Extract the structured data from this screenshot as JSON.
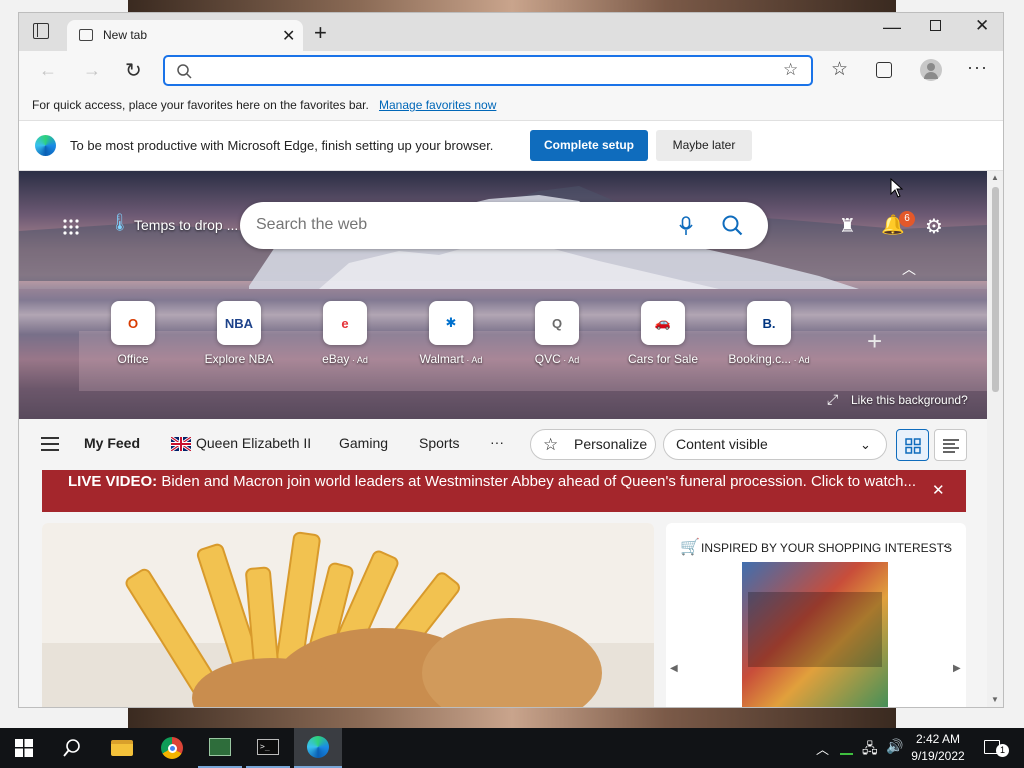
{
  "tab": {
    "title": "New tab"
  },
  "address": {
    "value": "",
    "placeholder": ""
  },
  "favbar": {
    "text": "For quick access, place your favorites here on the favorites bar.",
    "link": "Manage favorites now"
  },
  "setup": {
    "message": "To be most productive with Microsoft Edge, finish setting up your browser.",
    "primary": "Complete setup",
    "secondary": "Maybe later"
  },
  "hero": {
    "weather": "Temps to drop ...",
    "search_placeholder": "Search the web",
    "notif_count": "6",
    "like_bg": "Like this background?"
  },
  "tiles": [
    {
      "label": "Office",
      "ad": "",
      "icon": "office-icon",
      "color": "#d83b01",
      "glyph": "O"
    },
    {
      "label": "Explore NBA",
      "ad": "",
      "icon": "nba-icon",
      "color": "#1d428a",
      "glyph": "NBA"
    },
    {
      "label": "eBay",
      "ad": " · Ad",
      "icon": "ebay-icon",
      "color": "#e53238",
      "glyph": "e"
    },
    {
      "label": "Walmart",
      "ad": " · Ad",
      "icon": "walmart-icon",
      "color": "#0071ce",
      "glyph": "✱"
    },
    {
      "label": "QVC",
      "ad": " · Ad",
      "icon": "qvc-icon",
      "color": "#6b6b6b",
      "glyph": "Q"
    },
    {
      "label": "Cars for Sale",
      "ad": "",
      "icon": "car-icon",
      "color": "#e6522c",
      "glyph": "🚗"
    },
    {
      "label": "Booking.c...",
      "ad": " · Ad",
      "icon": "booking-icon",
      "color": "#003580",
      "glyph": "B."
    }
  ],
  "feed": {
    "my_feed": "My Feed",
    "topics": [
      "Queen Elizabeth II",
      "Gaming",
      "Sports"
    ],
    "more": "···",
    "personalize": "Personalize",
    "content_visible": "Content visible"
  },
  "banner": {
    "text": "LIVE VIDEO:",
    "rest": " Biden and Macron join world leaders at Westminster Abbey ahead of Queen's funeral procession. Click to watch..."
  },
  "shopping": {
    "title": "INSPIRED BY YOUR SHOPPING INTERESTS",
    "more": "···"
  },
  "taskbar": {
    "time": "2:42 AM",
    "date": "9/19/2022",
    "notif": "1"
  }
}
